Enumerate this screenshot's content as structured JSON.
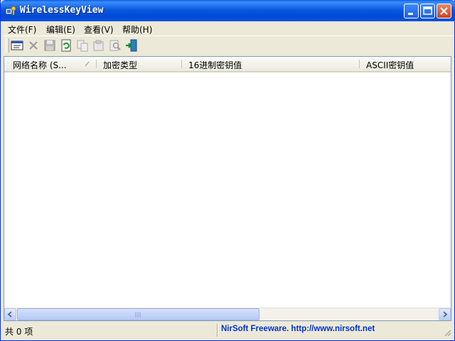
{
  "window": {
    "title": "WirelessKeyView",
    "buttons": {
      "minimize": "minimize",
      "maximize": "maximize",
      "close": "close"
    }
  },
  "menu": {
    "items": [
      {
        "label": "文件(F)"
      },
      {
        "label": "编辑(E)"
      },
      {
        "label": "查看(V)"
      },
      {
        "label": "帮助(H)"
      }
    ]
  },
  "toolbar": {
    "icons": [
      "properties-icon",
      "delete-icon",
      "save-icon",
      "refresh-icon",
      "copy-icon",
      "copy-key-icon",
      "find-icon",
      "exit-icon"
    ]
  },
  "list": {
    "columns": [
      {
        "label": "网络名称 (S..."
      },
      {
        "label": "加密类型"
      },
      {
        "label": "16进制密钥值"
      },
      {
        "label": "ASCII密钥值"
      }
    ],
    "rows": []
  },
  "status": {
    "count_text": "共 0 项",
    "link_text": "NirSoft Freeware.  http://www.nirsoft.net"
  },
  "colors": {
    "titlebar": "#0a5fe8",
    "status_link": "#0033cc",
    "chrome": "#ece9d8"
  }
}
